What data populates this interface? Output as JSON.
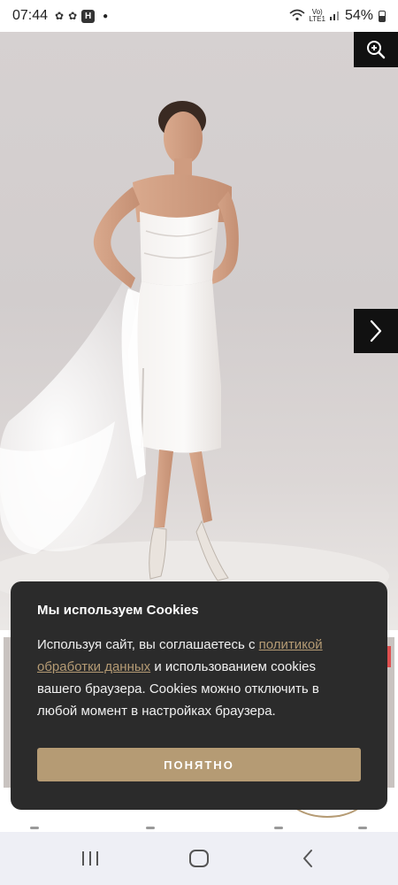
{
  "status_bar": {
    "time": "07:44",
    "notification_icons": [
      "notification-icon-1",
      "notification-icon-2"
    ],
    "app_icon_label": "H",
    "network_label_top": "Vo)",
    "network_label_bottom": "LTE1",
    "battery": "54%"
  },
  "gallery": {
    "zoom_icon": "zoom-in-icon",
    "next_icon": "chevron-right-icon"
  },
  "cookie": {
    "title": "Мы используем Cookies",
    "text_before_link": "Используя сайт, вы соглашаетесь с ",
    "link_text": "политикой обработки данных",
    "text_after_link": " и использованием cookies вашего браузера. Cookies можно отключить в любой момент в настройках браузера.",
    "button_label": "ПОНЯТНО",
    "accent_color": "#b59b74"
  },
  "nav_bar": {
    "recents_icon": "recents-icon",
    "home_icon": "home-icon",
    "back_icon": "back-icon"
  }
}
